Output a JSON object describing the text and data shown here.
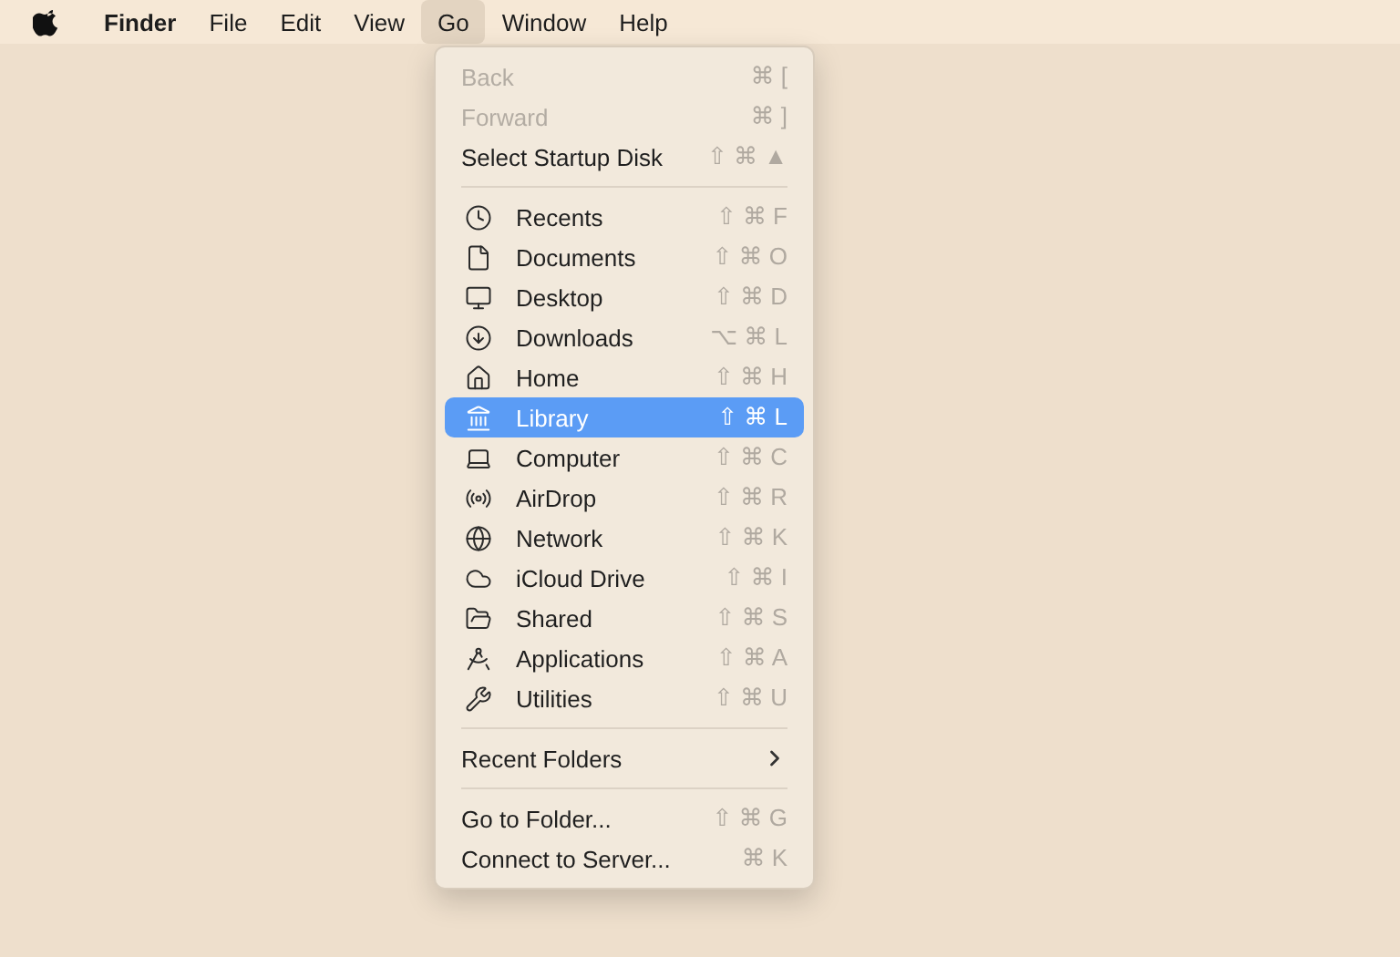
{
  "menubar": {
    "items": [
      {
        "label": "Finder",
        "kind": "app",
        "selected": false
      },
      {
        "label": "File",
        "kind": "menu",
        "selected": false
      },
      {
        "label": "Edit",
        "kind": "menu",
        "selected": false
      },
      {
        "label": "View",
        "kind": "menu",
        "selected": false
      },
      {
        "label": "Go",
        "kind": "menu",
        "selected": true
      },
      {
        "label": "Window",
        "kind": "menu",
        "selected": false
      },
      {
        "label": "Help",
        "kind": "menu",
        "selected": false
      }
    ]
  },
  "menu": {
    "sections": [
      {
        "items": [
          {
            "label": "Back",
            "shortcut": "⌘ [",
            "kind": "command",
            "disabled": true,
            "selected": false
          },
          {
            "label": "Forward",
            "shortcut": "⌘ ]",
            "kind": "command",
            "disabled": true,
            "selected": false
          },
          {
            "label": "Select Startup Disk",
            "shortcut": "⇧ ⌘ ▲",
            "kind": "command",
            "disabled": false,
            "selected": false
          }
        ]
      },
      {
        "items": [
          {
            "label": "Recents",
            "shortcut": "⇧ ⌘ F",
            "kind": "place",
            "disabled": false,
            "selected": false
          },
          {
            "label": "Documents",
            "shortcut": "⇧ ⌘ O",
            "kind": "place",
            "disabled": false,
            "selected": false
          },
          {
            "label": "Desktop",
            "shortcut": "⇧ ⌘ D",
            "kind": "place",
            "disabled": false,
            "selected": false
          },
          {
            "label": "Downloads",
            "shortcut": "⌥ ⌘ L",
            "kind": "place",
            "disabled": false,
            "selected": false
          },
          {
            "label": "Home",
            "shortcut": "⇧ ⌘ H",
            "kind": "place",
            "disabled": false,
            "selected": false
          },
          {
            "label": "Library",
            "shortcut": "⇧ ⌘ L",
            "kind": "place",
            "disabled": false,
            "selected": true
          },
          {
            "label": "Computer",
            "shortcut": "⇧ ⌘ C",
            "kind": "place",
            "disabled": false,
            "selected": false
          },
          {
            "label": "AirDrop",
            "shortcut": "⇧ ⌘ R",
            "kind": "place",
            "disabled": false,
            "selected": false
          },
          {
            "label": "Network",
            "shortcut": "⇧ ⌘ K",
            "kind": "place",
            "disabled": false,
            "selected": false
          },
          {
            "label": "iCloud Drive",
            "shortcut": "⇧ ⌘ I",
            "kind": "place",
            "disabled": false,
            "selected": false
          },
          {
            "label": "Shared",
            "shortcut": "⇧ ⌘ S",
            "kind": "place",
            "disabled": false,
            "selected": false
          },
          {
            "label": "Applications",
            "shortcut": "⇧ ⌘ A",
            "kind": "place",
            "disabled": false,
            "selected": false
          },
          {
            "label": "Utilities",
            "shortcut": "⇧ ⌘ U",
            "kind": "place",
            "disabled": false,
            "selected": false
          }
        ]
      },
      {
        "items": [
          {
            "label": "Recent Folders",
            "kind": "submenu",
            "disabled": false,
            "selected": false
          }
        ]
      },
      {
        "items": [
          {
            "label": "Go to Folder...",
            "shortcut": "⇧ ⌘ G",
            "kind": "command",
            "disabled": false,
            "selected": false
          },
          {
            "label": "Connect to Server...",
            "shortcut": "⌘ K",
            "kind": "command",
            "disabled": false,
            "selected": false
          }
        ]
      }
    ]
  }
}
